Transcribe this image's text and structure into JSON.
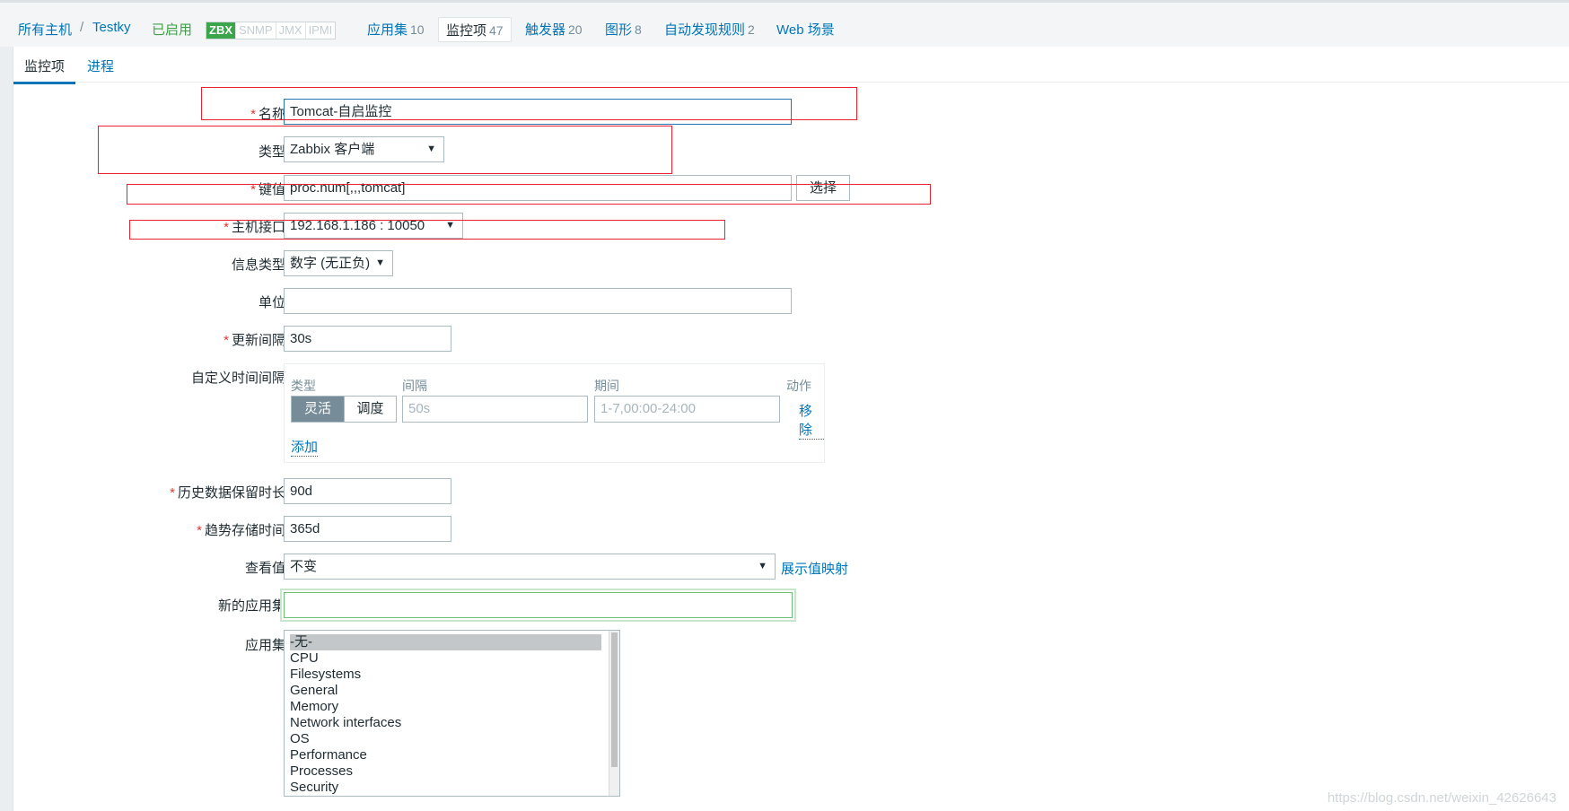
{
  "header": {
    "all_hosts": "所有主机",
    "separator": "/",
    "host": "Testky",
    "status": "已启用",
    "availability": [
      "ZBX",
      "SNMP",
      "JMX",
      "IPMI"
    ],
    "tabs": [
      {
        "label": "应用集",
        "count": "10"
      },
      {
        "label": "监控项",
        "count": "47"
      },
      {
        "label": "触发器",
        "count": "20"
      },
      {
        "label": "图形",
        "count": "8"
      },
      {
        "label": "自动发现规则",
        "count": "2"
      },
      {
        "label": "Web 场景",
        "count": ""
      }
    ]
  },
  "subtabs": [
    "监控项",
    "进程"
  ],
  "form": {
    "name_label": "名称",
    "name_value": "Tomcat-自启监控",
    "type_label": "类型",
    "type_value": "Zabbix 客户端",
    "key_label": "键值",
    "key_value": "proc.num[,,,tomcat]",
    "select_button": "选择",
    "interface_label": "主机接口",
    "interface_value": "192.168.1.186 : 10050",
    "info_type_label": "信息类型",
    "info_type_value": "数字 (无正负)",
    "units_label": "单位",
    "units_value": "",
    "interval_label": "更新间隔",
    "interval_value": "30s",
    "custom_label": "自定义时间间隔",
    "custom": {
      "col_type": "类型",
      "col_interval": "间隔",
      "col_period": "期间",
      "col_action": "动作",
      "flexible": "灵活",
      "scheduling": "调度",
      "interval_placeholder": "50s",
      "period_placeholder": "1-7,00:00-24:00",
      "remove": "移除",
      "add": "添加"
    },
    "history_label": "历史数据保留时长",
    "history_value": "90d",
    "trends_label": "趋势存储时间",
    "trends_value": "365d",
    "valuemap_label": "查看值",
    "valuemap_value": "不变",
    "valuemap_link": "展示值映射",
    "new_app_label": "新的应用集",
    "new_app_value": "",
    "apps_label": "应用集",
    "apps": [
      "-无-",
      "CPU",
      "Filesystems",
      "General",
      "Memory",
      "Network interfaces",
      "OS",
      "Performance",
      "Processes",
      "Security"
    ]
  },
  "watermark": "https://blog.csdn.net/weixin_42626643"
}
